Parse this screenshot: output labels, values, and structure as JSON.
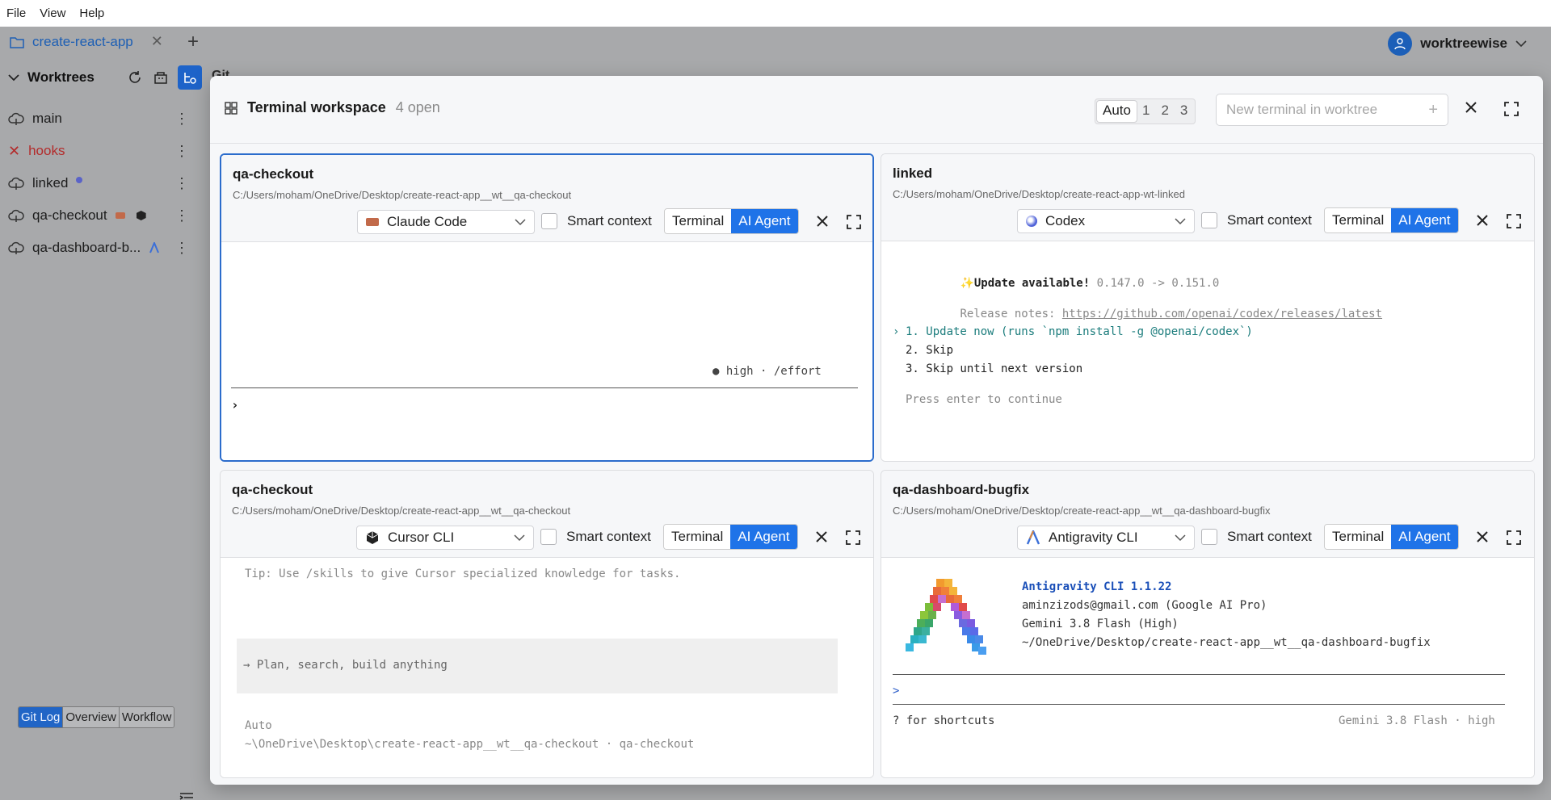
{
  "menubar": [
    "File",
    "View",
    "Help"
  ],
  "tab": {
    "label": "create-react-app",
    "close": "✕",
    "add": "+"
  },
  "user": {
    "name": "worktreewise"
  },
  "sidebar": {
    "title": "Worktrees",
    "items": [
      {
        "label": "main",
        "status": "ok"
      },
      {
        "label": "hooks",
        "status": "error"
      },
      {
        "label": "linked",
        "status": "ok"
      },
      {
        "label": "qa-checkout",
        "status": "ok"
      },
      {
        "label": "qa-dashboard-b...",
        "status": "ok"
      }
    ],
    "bottom_tabs": [
      "Git Log",
      "Overview",
      "Workflow"
    ]
  },
  "bg_peek": "Git ",
  "workspace": {
    "title": "Terminal workspace",
    "count": "4 open",
    "layout_options": [
      "Auto",
      "1",
      "2",
      "3"
    ],
    "layout_selected": "Auto",
    "new_terminal_placeholder": "New terminal in worktree"
  },
  "controls": {
    "smart_context": "Smart context",
    "terminal": "Terminal",
    "ai_agent": "AI Agent"
  },
  "panes": [
    {
      "name": "qa-checkout",
      "path": "C:/Users/moham/OneDrive/Desktop/create-react-app__wt__qa-checkout",
      "agent": "Claude Code",
      "status_line": "● high · /effort",
      "prompt": "›"
    },
    {
      "name": "linked",
      "path": "C:/Users/moham/OneDrive/Desktop/create-react-app-wt-linked",
      "agent": "Codex",
      "update_icon": "✨",
      "update_title": "Update available!",
      "update_version": " 0.147.0 -> 0.151.0",
      "release_label": "Release notes: ",
      "release_url": "https://github.com/openai/codex/releases/latest",
      "option_marker": "›",
      "options": [
        "1. Update now (runs `npm install -g @openai/codex`)",
        "2. Skip",
        "3. Skip until next version"
      ],
      "footer": "Press enter to continue"
    },
    {
      "name": "qa-checkout",
      "path": "C:/Users/moham/OneDrive/Desktop/create-react-app__wt__qa-checkout",
      "agent": "Cursor CLI",
      "tip": "Tip: Use /skills to give Cursor specialized knowledge for tasks.",
      "input_placeholder": "→ Plan, search, build anything",
      "mode": "Auto",
      "cwd": "~\\OneDrive\\Desktop\\create-react-app__wt__qa-checkout · qa-checkout"
    },
    {
      "name": "qa-dashboard-bugfix",
      "path": "C:/Users/moham/OneDrive/Desktop/create-react-app__wt__qa-dashboard-bugfix",
      "agent": "Antigravity CLI",
      "cli_title": "Antigravity CLI 1.1.22",
      "account": "aminzizods@gmail.com (Google AI Pro)",
      "model": "Gemini 3.8 Flash (High)",
      "cwd": "~/OneDrive/Desktop/create-react-app__wt__qa-dashboard-bugfix",
      "prompt": ">",
      "shortcuts": "? for shortcuts",
      "status": "Gemini 3.8 Flash · high"
    }
  ],
  "colors": {
    "accent": "#1f73e8",
    "error": "#b32b2b",
    "link_blue": "#1d5fb4"
  }
}
